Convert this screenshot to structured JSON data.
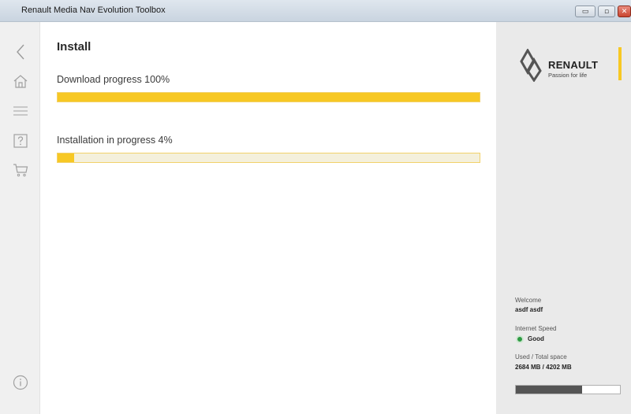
{
  "window": {
    "title": "Renault Media Nav Evolution Toolbox",
    "minimize_glyph": "▭",
    "maximize_glyph": "▫",
    "close_glyph": "✕"
  },
  "sidebar": {
    "icons": [
      "back-arrow-icon",
      "home-icon",
      "menu-icon",
      "help-icon",
      "cart-icon",
      "info-icon"
    ]
  },
  "main": {
    "title": "Install",
    "download": {
      "label": "Download progress 100%",
      "progress": 1.0
    },
    "installation": {
      "label": "Installation in progress 4%",
      "progress": 0.04
    }
  },
  "brand": {
    "name": "RENAULT",
    "tagline": "Passion for life",
    "accent_color": "#f7c824"
  },
  "user": {
    "welcome_label": "Welcome",
    "name": "asdf asdf",
    "internet_speed_label": "Internet Speed",
    "internet_speed_value": "Good",
    "internet_status_color": "#2e9a43",
    "space_label": "Used / Total space",
    "space_value": "2684 MB / 4202 MB",
    "space_used_fraction": 0.64
  }
}
